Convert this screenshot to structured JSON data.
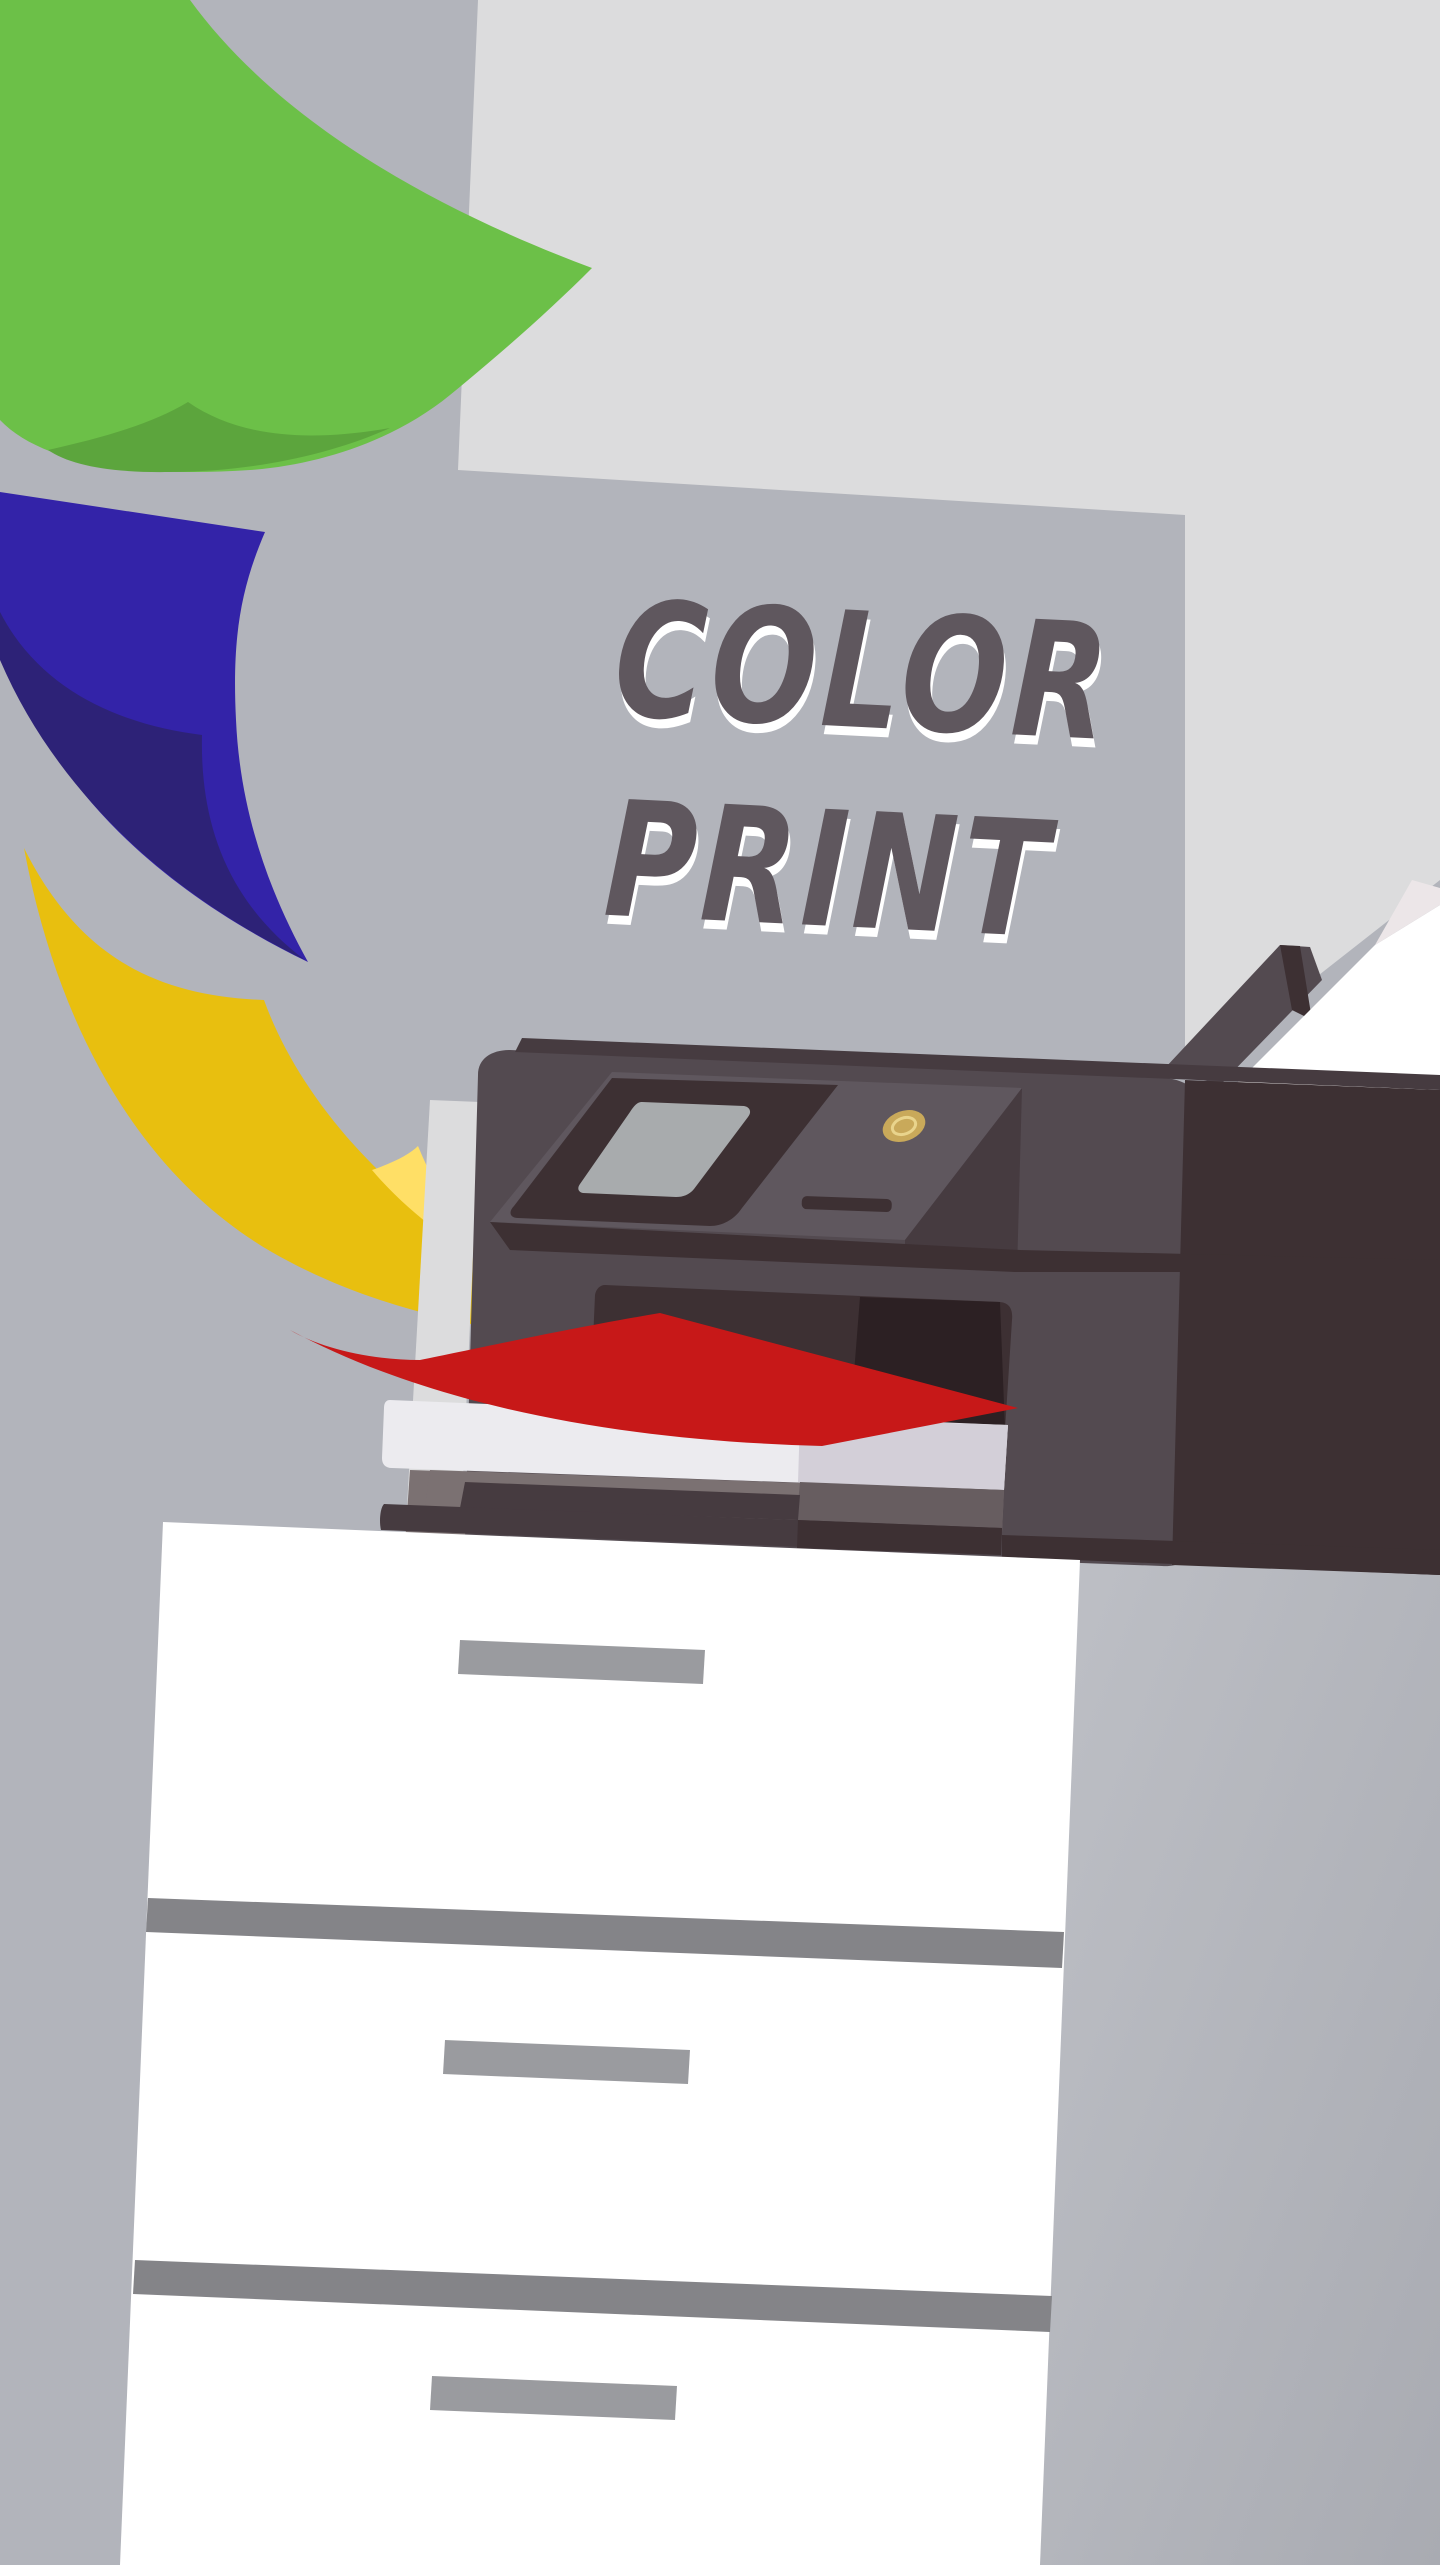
{
  "poster": {
    "title_line_1": "COLOR",
    "title_line_2": "PRINT"
  },
  "colors": {
    "background": "#b2b4bb",
    "wall_panel": "#dcdcdd",
    "green_sheet": "#6cc048",
    "blue_sheet": "#3323a8",
    "yellow_sheet": "#e8bf0f",
    "red_sheet": "#c71818",
    "printer_body": "#534a50",
    "cabinet": "#ffffff",
    "title_text": "#5f575e"
  }
}
